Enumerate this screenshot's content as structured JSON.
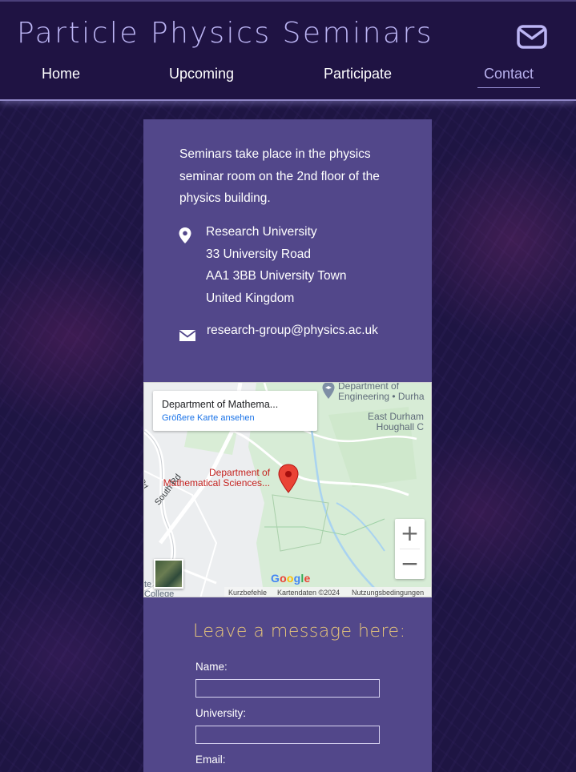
{
  "header": {
    "title": "Particle Physics Seminars",
    "mail_icon": "envelope-icon",
    "title_color": "#bcb5f4",
    "background": "#1f1343"
  },
  "nav": {
    "items": [
      {
        "label": "Home",
        "active": false
      },
      {
        "label": "Upcoming",
        "active": false
      },
      {
        "label": "Participate",
        "active": false
      },
      {
        "label": "Contact",
        "active": true
      }
    ],
    "active_color": "#b7b0ec"
  },
  "contact": {
    "intro": "Seminars take place in the physics seminar room on the 2nd floor of the physics building.",
    "address": [
      "Research University",
      "33 University Road",
      "AA1 3BB University Town",
      "United Kingdom"
    ],
    "email": "research-group@physics.ac.uk",
    "panel_color": "#52478a"
  },
  "map": {
    "card_title": "Department of Mathema...",
    "card_link": "Größere Karte ansehen",
    "place_label_line1": "Department of",
    "place_label_line2": "Mathematical Sciences...",
    "top_label_line1": "Department of",
    "top_label_line2": "Engineering • Durha",
    "east_label_line1": "East Durham",
    "east_label_line2": "Houghall C",
    "road_label": "South Rd",
    "road_label_small": "Rd",
    "corner_label_line1": "te   on",
    "corner_label_line2": "College",
    "zoom_in": "+",
    "zoom_out": "−",
    "logo": "Google",
    "footer": [
      "Kurzbefehle",
      "Kartendaten ©2024",
      "Nutzungsbedingungen"
    ]
  },
  "form": {
    "heading": "Leave a message here:",
    "heading_color": "#e8c67a",
    "fields": [
      {
        "label": "Name:",
        "value": ""
      },
      {
        "label": "University:",
        "value": ""
      },
      {
        "label": "Email:",
        "value": ""
      }
    ]
  }
}
